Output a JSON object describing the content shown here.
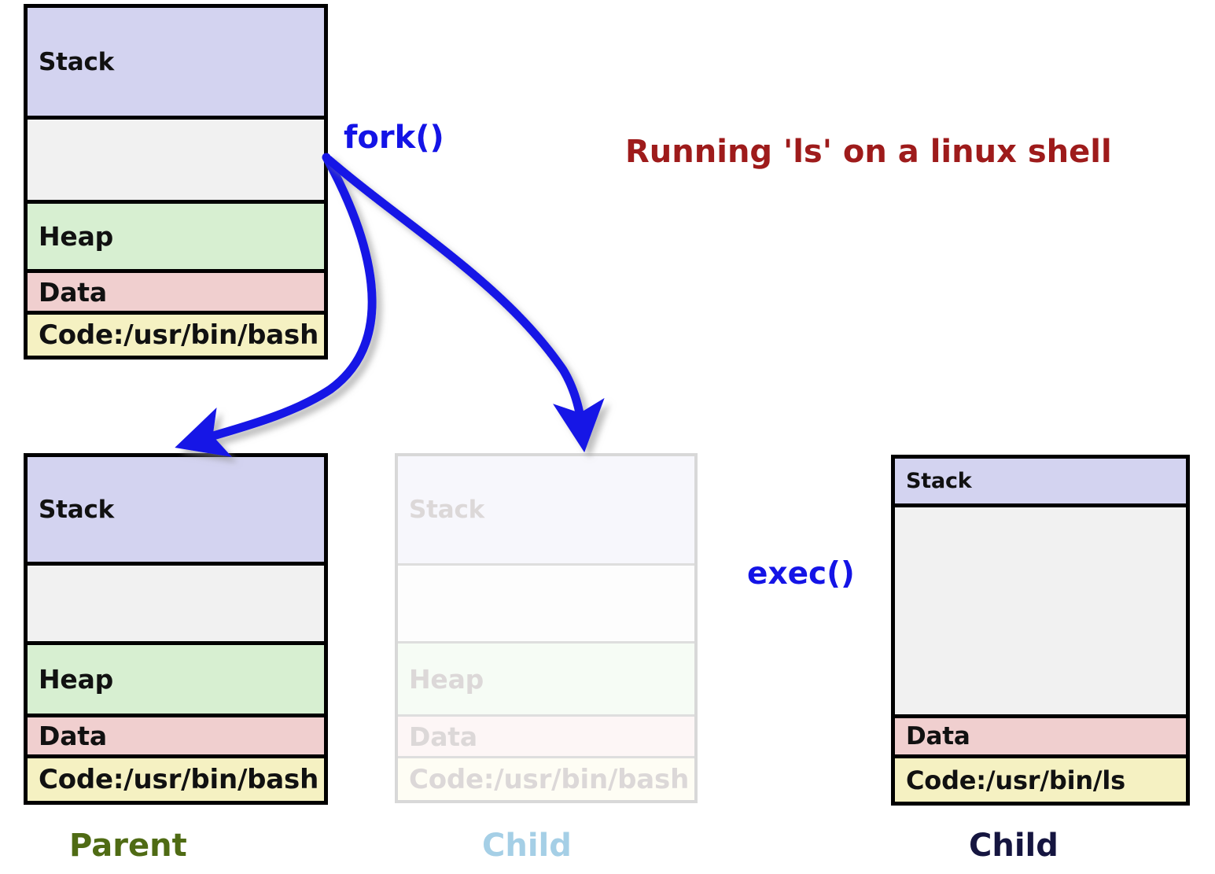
{
  "title": {
    "text": "Running 'ls' on a linux shell",
    "color": "#9e1b1b"
  },
  "labels": {
    "fork": "fork()",
    "exec": "exec()",
    "call_color": "#1414e6"
  },
  "captions": {
    "parent": "Parent",
    "child_ghost": "Child",
    "child_exec": "Child",
    "parent_color": "#4f6b14",
    "child_ghost_color": "#a5cfe6",
    "child_exec_color": "#151540"
  },
  "segment_colors": {
    "stack": "#d3d3f0",
    "gap": "#f1f1f1",
    "heap": "#d7efd1",
    "data": "#f0cfcf",
    "code": "#f5f1c2",
    "border": "#000000"
  },
  "arrows": {
    "fork_solid": {
      "color": "#1414e6",
      "style": "solid"
    },
    "fork_dotted": {
      "color": "#1414e6",
      "style": "dotted"
    },
    "exec": {
      "color": "#b01414",
      "style": "solid"
    }
  },
  "boxes": {
    "shell": {
      "name": "shell-process",
      "segments": [
        {
          "kind": "stack",
          "label": "Stack"
        },
        {
          "kind": "gap",
          "label": ""
        },
        {
          "kind": "heap",
          "label": "Heap"
        },
        {
          "kind": "data",
          "label": "Data"
        },
        {
          "kind": "code",
          "label": "Code:/usr/bin/bash"
        }
      ]
    },
    "parent": {
      "name": "parent-process",
      "segments": [
        {
          "kind": "stack",
          "label": "Stack"
        },
        {
          "kind": "gap",
          "label": ""
        },
        {
          "kind": "heap",
          "label": "Heap"
        },
        {
          "kind": "data",
          "label": "Data"
        },
        {
          "kind": "code",
          "label": "Code:/usr/bin/bash"
        }
      ]
    },
    "child_ghost": {
      "name": "child-process-ghost",
      "segments": [
        {
          "kind": "stack",
          "label": "Stack"
        },
        {
          "kind": "gap",
          "label": ""
        },
        {
          "kind": "heap",
          "label": "Heap"
        },
        {
          "kind": "data",
          "label": "Data"
        },
        {
          "kind": "code",
          "label": "Code:/usr/bin/bash"
        }
      ]
    },
    "child_exec": {
      "name": "child-process-exec",
      "segments": [
        {
          "kind": "stack",
          "label": "Stack"
        },
        {
          "kind": "gap",
          "label": ""
        },
        {
          "kind": "data",
          "label": "Data"
        },
        {
          "kind": "code",
          "label": "Code:/usr/bin/ls"
        }
      ]
    }
  }
}
